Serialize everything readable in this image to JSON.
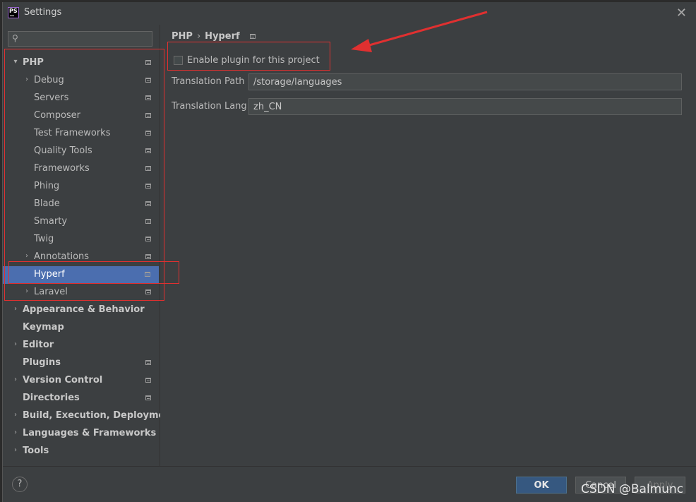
{
  "window": {
    "title": "Settings",
    "close_glyph": "✕"
  },
  "search": {
    "placeholder": "",
    "value": ""
  },
  "tree": {
    "php": {
      "label": "PHP",
      "children": {
        "debug": "Debug",
        "servers": "Servers",
        "composer": "Composer",
        "test_frameworks": "Test Frameworks",
        "quality_tools": "Quality Tools",
        "frameworks": "Frameworks",
        "phing": "Phing",
        "blade": "Blade",
        "smarty": "Smarty",
        "twig": "Twig",
        "annotations": "Annotations",
        "hyperf": "Hyperf",
        "laravel": "Laravel"
      }
    },
    "appearance": "Appearance & Behavior",
    "keymap": "Keymap",
    "editor": "Editor",
    "plugins": "Plugins",
    "version_control": "Version Control",
    "directories": "Directories",
    "build": "Build, Execution, Deployment",
    "languages": "Languages & Frameworks",
    "tools": "Tools"
  },
  "breadcrumb": {
    "parent": "PHP",
    "separator": "›",
    "current": "Hyperf"
  },
  "settings": {
    "enable_plugin_label": "Enable plugin for this project",
    "enable_plugin_checked": false,
    "translation_path_label": "Translation Path",
    "translation_path_value": "/storage/languages",
    "translation_lang_label": "Translation Lang",
    "translation_lang_value": "zh_CN"
  },
  "footer": {
    "help": "?",
    "ok": "OK",
    "cancel": "Cancel",
    "apply": "Apply"
  },
  "watermark": "CSDN @Balmunc",
  "colors": {
    "annotation": "#e03030",
    "selection": "#4b6eaf"
  },
  "icons": {
    "chevron_right": "›",
    "chevron_down": "⌄",
    "search": "⚲",
    "config": "project-config-icon",
    "app": "phpstorm-app-icon"
  }
}
